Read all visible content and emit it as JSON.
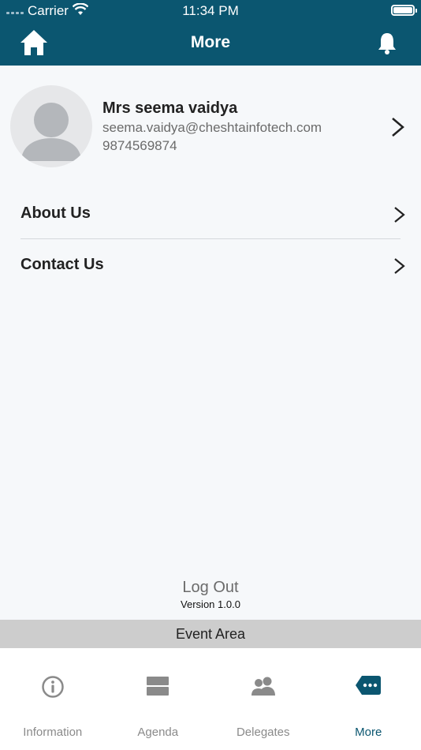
{
  "status_bar": {
    "carrier": "Carrier",
    "time": "11:34 PM"
  },
  "header": {
    "title": "More",
    "home_icon": "home-icon",
    "bell_icon": "bell-icon"
  },
  "profile": {
    "name": "Mrs seema vaidya",
    "email": "seema.vaidya@cheshtainfotech.com",
    "phone": "9874569874"
  },
  "menu": [
    {
      "label": "About Us"
    },
    {
      "label": "Contact Us"
    }
  ],
  "footer": {
    "logout": "Log Out",
    "version": "Version 1.0.0",
    "event_area": "Event Area"
  },
  "tabs": [
    {
      "label": "Information",
      "icon": "info-icon"
    },
    {
      "label": "Agenda",
      "icon": "agenda-icon"
    },
    {
      "label": "Delegates",
      "icon": "delegates-icon"
    },
    {
      "label": "More",
      "icon": "more-icon",
      "active": true
    }
  ],
  "colors": {
    "brand": "#0b5670",
    "tab_inactive": "#8a8a8a",
    "event_bar": "#cdcdcd"
  }
}
